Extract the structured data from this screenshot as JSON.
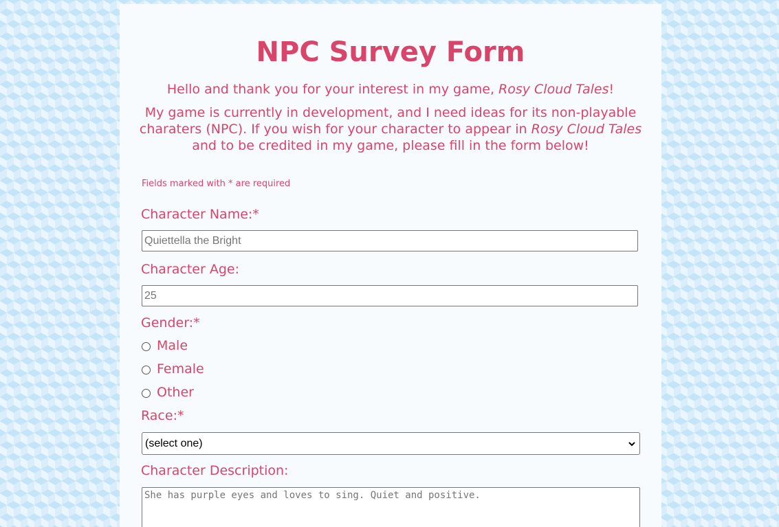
{
  "page": {
    "title": "NPC Survey Form",
    "intro_line1_prefix": "Hello and thank you for your interest in my game, ",
    "game_name": "Rosy Cloud Tales",
    "intro_line1_suffix": "!",
    "intro_line2_prefix": "My game is currently in development, and I need ideas for its non-playable charaters (NPC). If you wish for your character to appear in ",
    "intro_line2_suffix": " and to be credited in my game, please fill in the form below!",
    "required_note": "Fields marked with * are required"
  },
  "form": {
    "name_label": "Character Name:*",
    "name_placeholder": "Quiettella the Bright",
    "age_label": "Character Age:",
    "age_placeholder": "25",
    "gender_label": "Gender:*",
    "gender_options": [
      "Male",
      "Female",
      "Other"
    ],
    "race_label": "Race:*",
    "race_selected": "(select one)",
    "description_label": "Character Description:",
    "description_placeholder": "She has purple eyes and loves to sing. Quiet and positive."
  },
  "colors": {
    "accent": "#d9456a",
    "panel": "#f7fbfd",
    "background": "#d9eefa"
  }
}
